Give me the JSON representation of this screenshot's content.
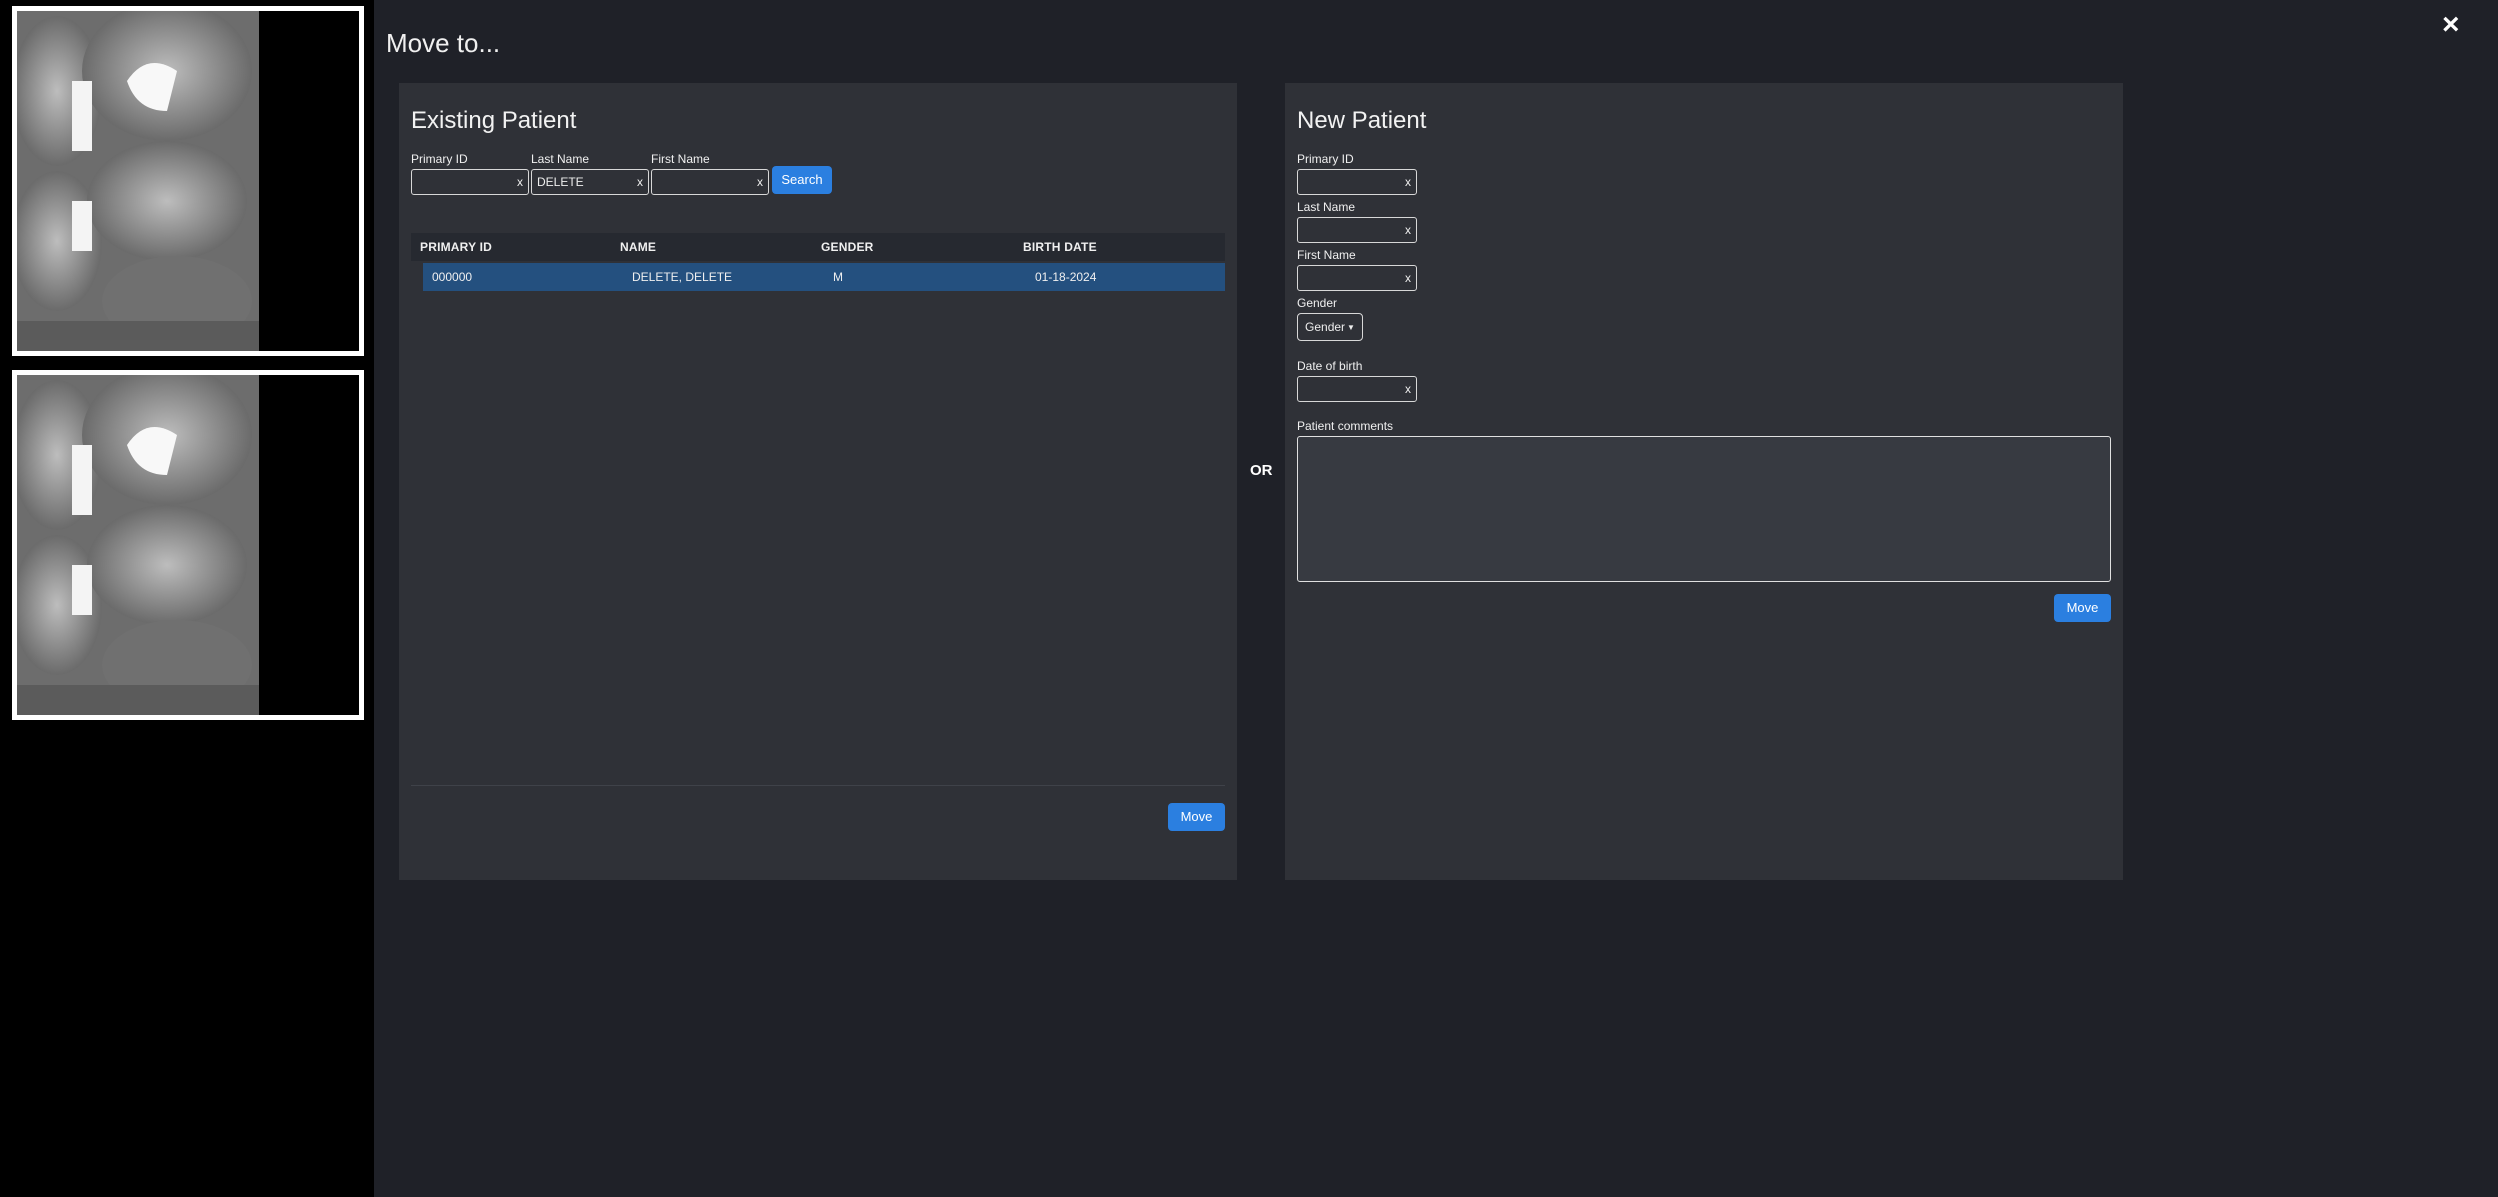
{
  "dialog": {
    "title": "Move to...",
    "close_label": "×",
    "or_label": "OR"
  },
  "existing": {
    "title": "Existing Patient",
    "fields": {
      "primary_id": {
        "label": "Primary ID",
        "value": ""
      },
      "last_name": {
        "label": "Last Name",
        "value": "DELETE"
      },
      "first_name": {
        "label": "First Name",
        "value": ""
      }
    },
    "clear_label": "x",
    "search_label": "Search",
    "table": {
      "columns": [
        "PRIMARY ID",
        "NAME",
        "GENDER",
        "BIRTH DATE"
      ],
      "rows": [
        {
          "primary_id": "000000",
          "name": "DELETE, DELETE",
          "gender": "M",
          "birth_date": "01-18-2024"
        }
      ]
    },
    "move_label": "Move"
  },
  "new_patient": {
    "title": "New Patient",
    "primary_id_label": "Primary ID",
    "last_name_label": "Last Name",
    "first_name_label": "First Name",
    "gender_label": "Gender",
    "gender_value": "Gender",
    "dob_label": "Date of birth",
    "comments_label": "Patient comments",
    "clear_label": "x",
    "move_label": "Move"
  },
  "colors": {
    "accent": "#2b7fe0",
    "selected_row": "#24507f",
    "panel": "#2f3137",
    "background": "#1f2128"
  }
}
